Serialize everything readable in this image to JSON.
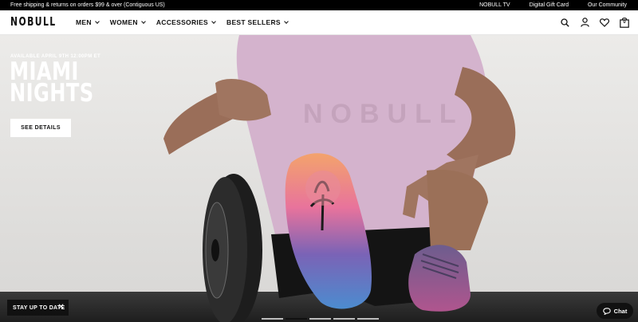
{
  "announcement": {
    "left_text": "Free shipping & returns on orders $99 & over (Contiguous US)",
    "links": [
      "NOBULL TV",
      "Digital Gift Card",
      "Our Community"
    ]
  },
  "header": {
    "logo": "NOBULL",
    "nav": [
      "MEN",
      "WOMEN",
      "ACCESSORIES",
      "BEST SELLERS"
    ],
    "icons": [
      "search-icon",
      "account-icon",
      "heart-icon",
      "bag-icon"
    ],
    "bag_count": "0"
  },
  "hero": {
    "eyebrow": "AVAILABLE APRIL 9TH 12:00PM ET",
    "title_line1": "MIAMI",
    "title_line2": "NIGHTS",
    "cta": "SEE DETAILS",
    "shirt_print": "NOBULL"
  },
  "newsletter": {
    "label": "STAY UP TO DATE",
    "close": "✕"
  },
  "chat": {
    "label": "Chat"
  },
  "carousel": {
    "slides": 5,
    "active_index": 1
  },
  "colors": {
    "shirt": "#d4b3cd",
    "sole_blue": "#4e7fc4",
    "sole_pink": "#e07a9a",
    "shoe_purple": "#6b5a8a"
  }
}
